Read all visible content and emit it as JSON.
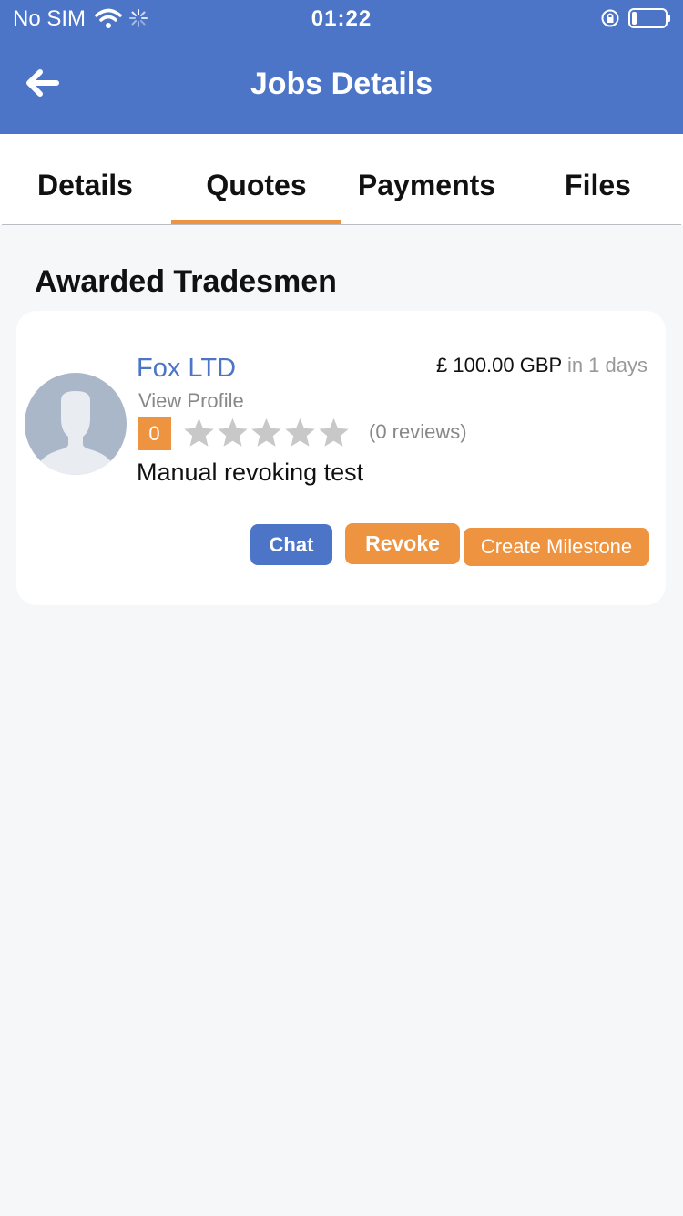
{
  "status_bar": {
    "carrier": "No SIM",
    "time": "01:22",
    "battery_level": 0.15
  },
  "header": {
    "title": "Jobs Details"
  },
  "tabs": [
    {
      "label": "Details",
      "active": false
    },
    {
      "label": "Quotes",
      "active": true
    },
    {
      "label": "Payments",
      "active": false
    },
    {
      "label": "Files",
      "active": false
    }
  ],
  "section": {
    "title": "Awarded Tradesmen"
  },
  "tradesman": {
    "name": "Fox LTD",
    "price": "£ 100.00 GBP",
    "duration": "in 1 days",
    "view_profile": "View Profile",
    "rating": "0",
    "stars_filled": 0,
    "stars_total": 5,
    "reviews": "(0 reviews)",
    "description": "Manual revoking test"
  },
  "actions": {
    "chat": "Chat",
    "revoke": "Revoke",
    "create_milestone": "Create Milestone"
  },
  "colors": {
    "primary": "#4c75c8",
    "accent": "#ee9340",
    "star_empty": "#c8c8c8"
  }
}
